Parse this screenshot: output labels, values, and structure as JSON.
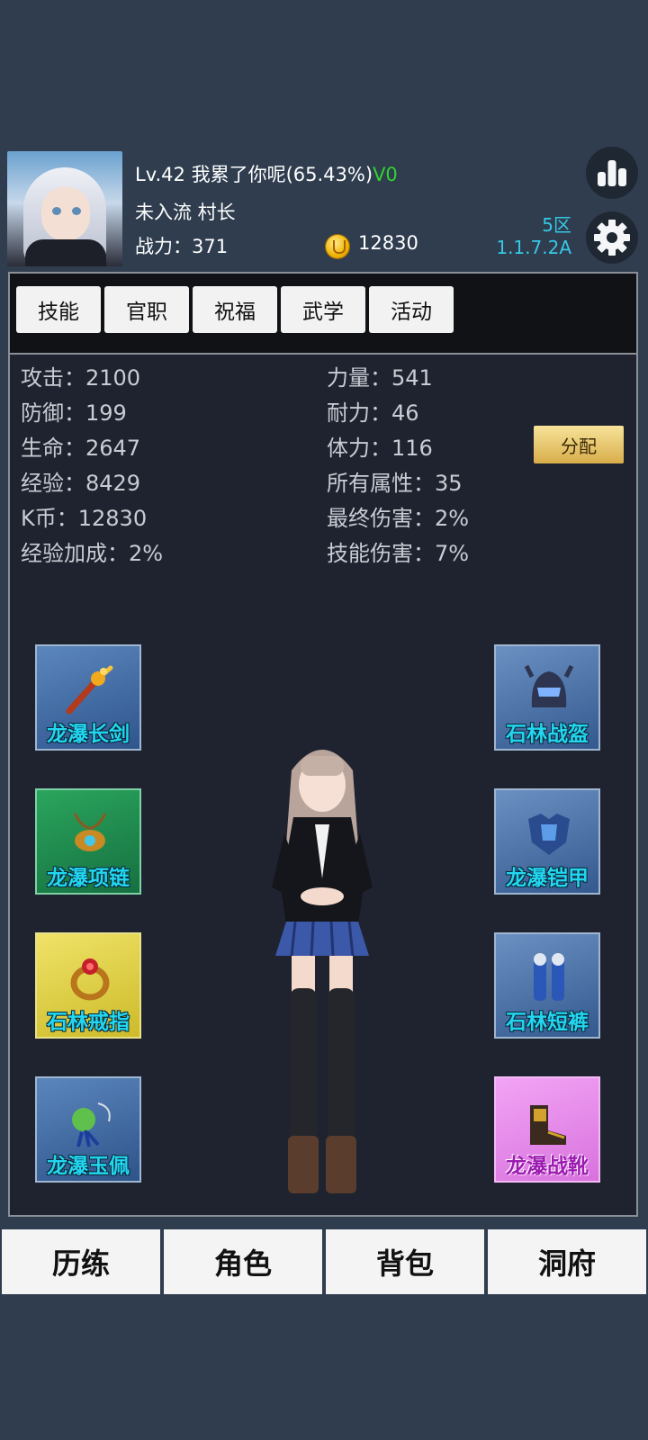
{
  "header": {
    "level": "Lv.42",
    "player_name": "我累了你呢(65.43%)",
    "vip": "V0",
    "rank_text": "未入流 村长",
    "power_label": "战力：",
    "power_value": "371",
    "coins": "12830",
    "server_zone": "5区",
    "version": "1.1.7.2A"
  },
  "tabs": [
    "技能",
    "官职",
    "祝福",
    "武学",
    "活动"
  ],
  "stats_left": [
    {
      "label": "攻击：",
      "value": "2100"
    },
    {
      "label": "防御：",
      "value": "199"
    },
    {
      "label": "生命：",
      "value": "2647"
    },
    {
      "label": "经验：",
      "value": "8429"
    },
    {
      "label": "K币：",
      "value": "12830"
    },
    {
      "label": "经验加成：",
      "value": "2%"
    }
  ],
  "stats_right": [
    {
      "label": "力量：",
      "value": "541"
    },
    {
      "label": "耐力：",
      "value": "46"
    },
    {
      "label": "体力：",
      "value": "116"
    },
    {
      "label": "所有属性：",
      "value": "35"
    },
    {
      "label": "最终伤害：",
      "value": "2%"
    },
    {
      "label": "技能伤害：",
      "value": "7%"
    }
  ],
  "allocate_label": "分配",
  "equipment": {
    "weapon": "龙瀑长剑",
    "necklace": "龙瀑项链",
    "ring": "石林戒指",
    "pendant": "龙瀑玉佩",
    "helmet": "石林战盔",
    "armor": "龙瀑铠甲",
    "pants": "石林短裤",
    "boots": "龙瀑战靴"
  },
  "nav": [
    "历练",
    "角色",
    "背包",
    "洞府"
  ],
  "colors": {
    "background": "#2f3d4f",
    "accent_cyan": "#35c8e6",
    "vip_green": "#31d231",
    "slot_blue": "#3b6aa6",
    "slot_green": "#1f8a4c",
    "slot_yellow": "#e1d24a",
    "slot_pink": "#e58ee9"
  }
}
